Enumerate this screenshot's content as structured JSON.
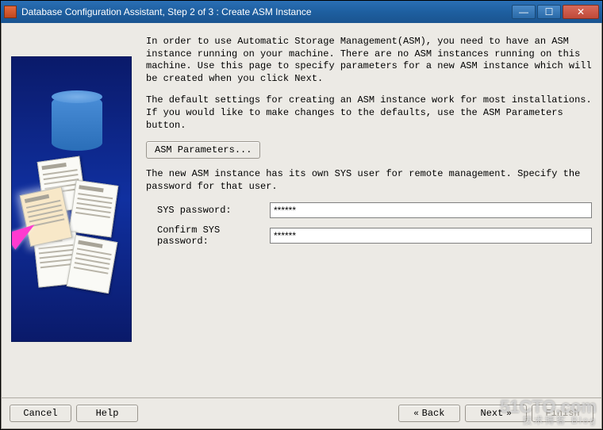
{
  "window": {
    "title": "Database Configuration Assistant, Step 2 of 3 : Create ASM Instance"
  },
  "text": {
    "intro": "In order to use Automatic Storage Management(ASM), you need to have an ASM instance running on your machine. There are no ASM instances running on this machine. Use this page to specify parameters for a new ASM instance which will be created when you click Next.",
    "defaults": "The default settings for creating an ASM instance work for most installations. If you would like to make changes to the defaults, use the ASM Parameters button.",
    "newinst": "The new ASM instance has its own SYS user for remote management. Specify the password for that user."
  },
  "buttons": {
    "asm_params": "ASM Parameters...",
    "cancel": "Cancel",
    "help": "Help",
    "back": "Back",
    "next": "Next",
    "finish": "Finish"
  },
  "form": {
    "sys_label": "SYS password:",
    "sys_value": "******",
    "confirm_label": "Confirm SYS password:",
    "confirm_value": "******"
  },
  "watermark": {
    "main": "51CTO.com",
    "sub": "技术博客  Blog"
  }
}
